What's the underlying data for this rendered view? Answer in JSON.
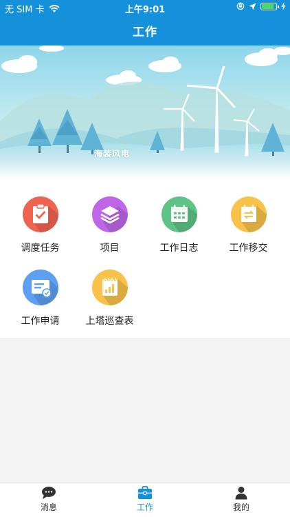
{
  "status_bar": {
    "carrier": "无 SIM 卡",
    "time": "上午9:01",
    "battery_level": 0.9
  },
  "header": {
    "title": "工作"
  },
  "banner": {
    "label": "海装风电"
  },
  "grid": {
    "items": [
      {
        "label": "调度任务",
        "icon": "clipboard-check-icon",
        "color": "#ef6450"
      },
      {
        "label": "项目",
        "icon": "layers-icon",
        "color": "#bd67e8"
      },
      {
        "label": "工作日志",
        "icon": "calendar-icon",
        "color": "#5ec386"
      },
      {
        "label": "工作移交",
        "icon": "transfer-icon",
        "color": "#f9c24a"
      },
      {
        "label": "工作申请",
        "icon": "application-form-icon",
        "color": "#5d9ff0"
      },
      {
        "label": "上塔巡查表",
        "icon": "bar-chart-notepad-icon",
        "color": "#f9c24a"
      }
    ]
  },
  "tabbar": {
    "active_color": "#1591dc",
    "inactive_color": "#333333",
    "tabs": [
      {
        "label": "消息",
        "icon": "chat-bubble-icon",
        "active": false
      },
      {
        "label": "工作",
        "icon": "briefcase-icon",
        "active": true
      },
      {
        "label": "我的",
        "icon": "person-icon",
        "active": false
      }
    ]
  }
}
